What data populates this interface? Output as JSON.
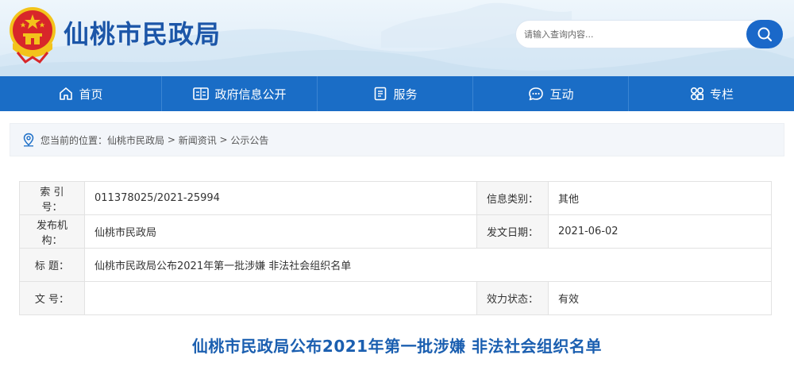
{
  "header": {
    "site_title": "仙桃市民政局",
    "search_placeholder": "请输入查询内容..."
  },
  "nav": {
    "items": [
      {
        "label": "首页",
        "icon": "home-icon"
      },
      {
        "label": "政府信息公开",
        "icon": "info-panel-icon"
      },
      {
        "label": "服务",
        "icon": "document-icon"
      },
      {
        "label": "互动",
        "icon": "chat-icon"
      },
      {
        "label": "专栏",
        "icon": "grid-icon"
      }
    ]
  },
  "breadcrumb": {
    "prefix": "您当前的位置：",
    "items": [
      "仙桃市民政局",
      "新闻资讯",
      "公示公告"
    ],
    "separator": " > "
  },
  "info": {
    "rows": [
      {
        "label": "索 引 号：",
        "value": "011378025/2021-25994",
        "label2": "信息类别：",
        "value2": "其他"
      },
      {
        "label": "发布机构：",
        "value": "仙桃市民政局",
        "label2": "发文日期：",
        "value2": "2021-06-02"
      },
      {
        "label": "标 题：",
        "value": "仙桃市民政局公布2021年第一批涉嫌 非法社会组织名单"
      },
      {
        "label": "文 号：",
        "value": "",
        "label2": "效力状态：",
        "value2": "有效"
      }
    ]
  },
  "article": {
    "title": "仙桃市民政局公布2021年第一批涉嫌 非法社会组织名单"
  },
  "colors": {
    "brand_blue": "#1a6dc6",
    "title_blue": "#1c56a8",
    "emblem_red": "#d8262a",
    "emblem_gold": "#f3c31b"
  }
}
